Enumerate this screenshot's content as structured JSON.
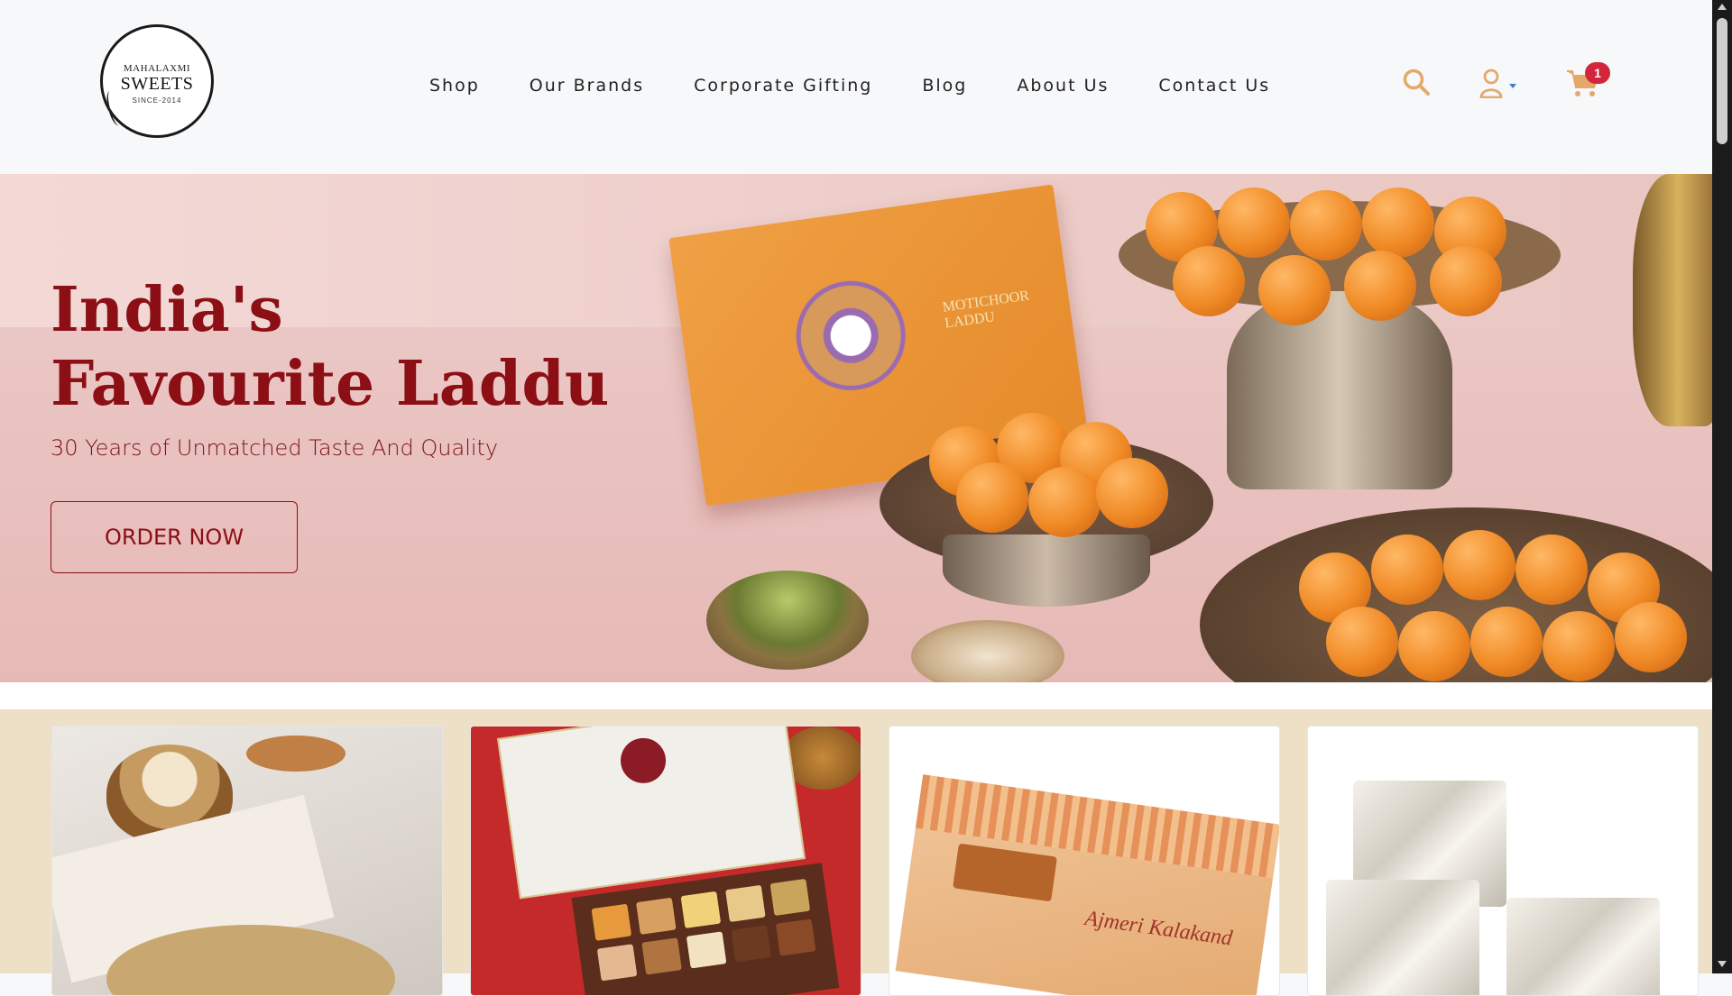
{
  "logo": {
    "line1": "MAHALAXMI",
    "line2": "SWEETS",
    "line3": "SINCE-2014"
  },
  "nav": {
    "items": [
      {
        "label": "Shop"
      },
      {
        "label": "Our Brands"
      },
      {
        "label": "Corporate Gifting"
      },
      {
        "label": "Blog"
      },
      {
        "label": "About Us"
      },
      {
        "label": "Contact Us"
      }
    ]
  },
  "header_icons": {
    "search": "search-icon",
    "account": "user-icon",
    "cart": "cart-icon",
    "cart_count": "1",
    "icon_color": "#e3a86a",
    "badge_color": "#d3263a"
  },
  "hero": {
    "title": "India's Favourite Laddu",
    "subtitle": "30 Years of Unmatched Taste And Quality",
    "cta_label": "ORDER NOW",
    "accent_color": "#8b0f14",
    "box_label": "MOTICHOOR LADDU"
  },
  "categories": {
    "kalakand_label": "Ajmeri Kalakand"
  }
}
